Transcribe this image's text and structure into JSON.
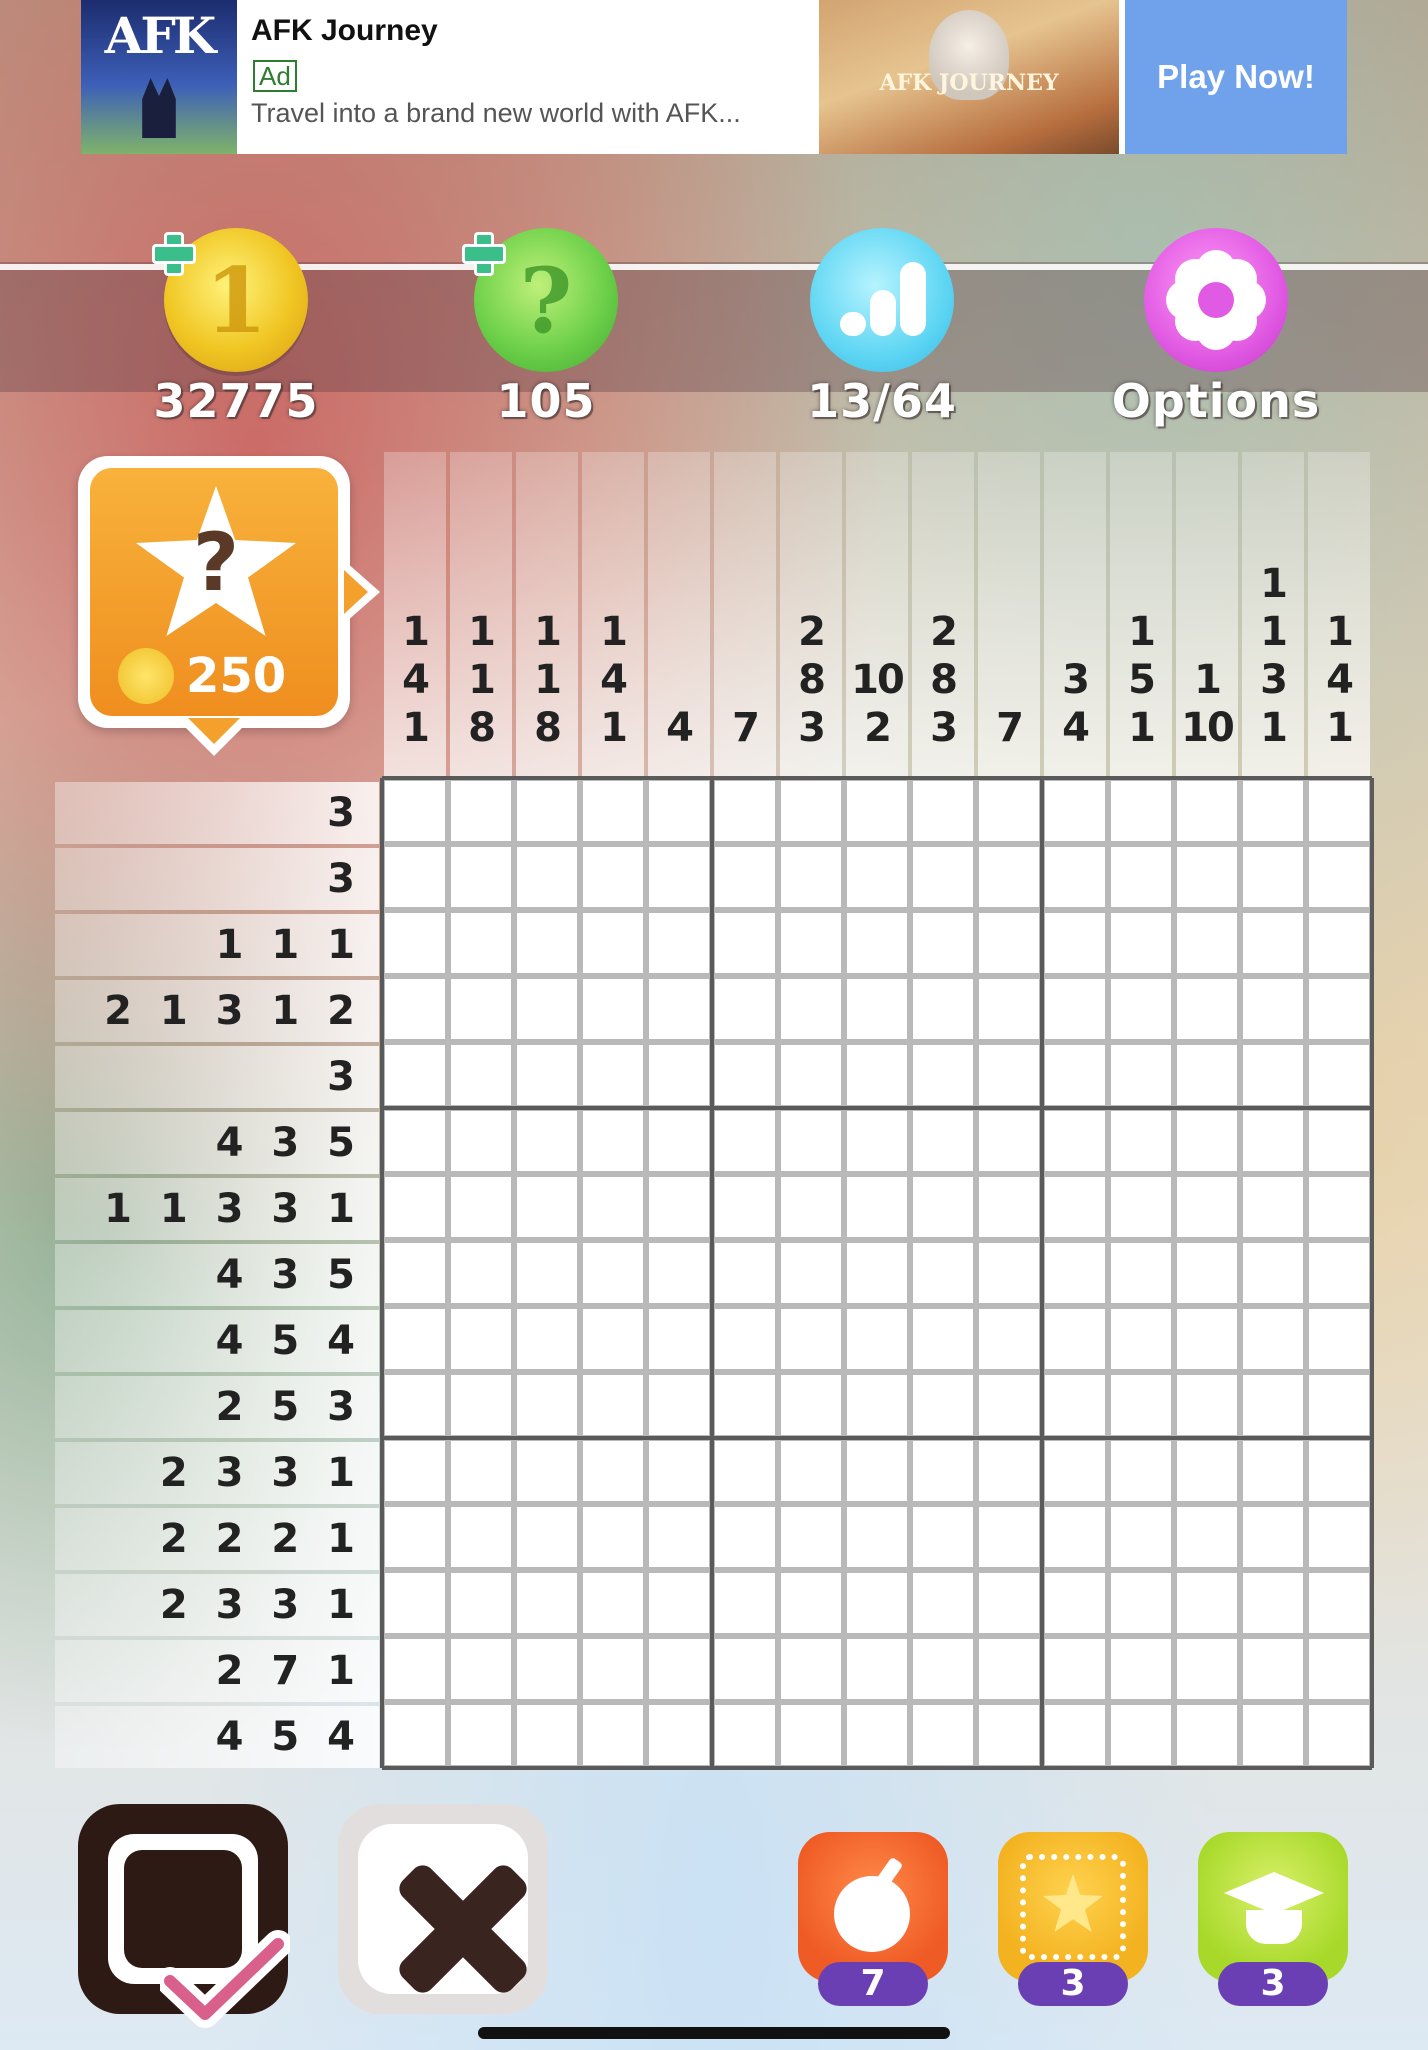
{
  "ad": {
    "logo_text": "AFK",
    "title": "AFK Journey",
    "badge": "Ad",
    "description": "Travel into a brand new world with AFK...",
    "image_text": "AFK JOURNEY",
    "cta": "Play Now!"
  },
  "stats": {
    "coins": "32775",
    "hints": "105",
    "progress": "13/64",
    "options": "Options"
  },
  "reward": {
    "cost": "250"
  },
  "puzzle": {
    "column_clues": [
      [
        "1",
        "4",
        "1"
      ],
      [
        "1",
        "1",
        "8"
      ],
      [
        "1",
        "1",
        "8"
      ],
      [
        "1",
        "4",
        "1"
      ],
      [
        "4"
      ],
      [
        "7"
      ],
      [
        "2",
        "8",
        "3"
      ],
      [
        "10",
        "2"
      ],
      [
        "2",
        "8",
        "3"
      ],
      [
        "7"
      ],
      [
        "3",
        "4"
      ],
      [
        "1",
        "5",
        "1"
      ],
      [
        "1",
        "10"
      ],
      [
        "1",
        "1",
        "3",
        "1"
      ],
      [
        "1",
        "4",
        "1"
      ]
    ],
    "row_clues": [
      "3",
      "3",
      "1 1 1",
      "2 1 3 1 2",
      "3",
      "4 3 5",
      "1 1 3 3 1",
      "4 3 5",
      "4 5 4",
      "2 5 3",
      "2 3 3 1",
      "2 2 2 1",
      "2 3 3 1",
      "2 7 1",
      "4 5 4"
    ],
    "size": 15
  },
  "tools": {
    "bomb_count": "7",
    "reveal_count": "3",
    "learn_count": "3"
  },
  "icons": [
    "coin-icon",
    "hint-icon",
    "stats-icon",
    "gear-icon",
    "star-question-icon",
    "fill-mode-icon",
    "cross-mode-icon",
    "bomb-icon",
    "reveal-icon",
    "graduation-cap-icon"
  ]
}
